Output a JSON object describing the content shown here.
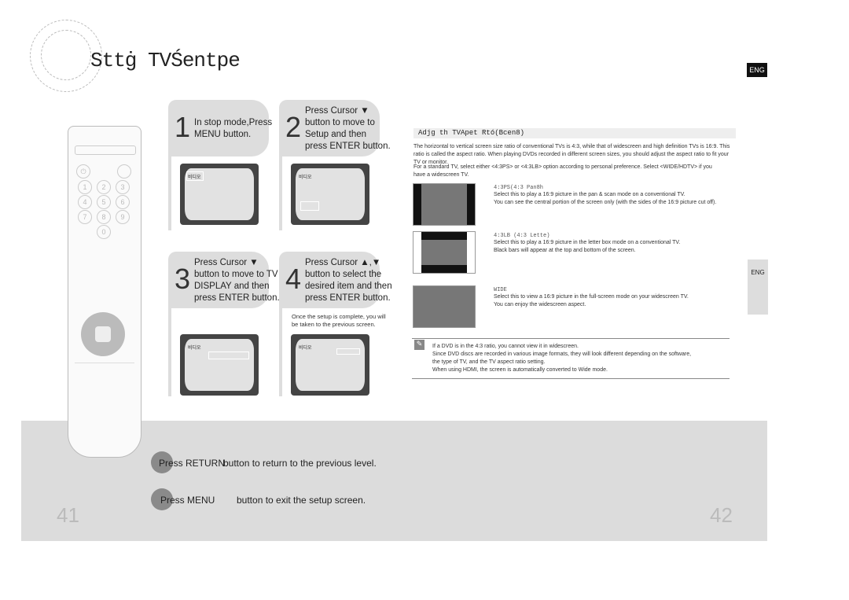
{
  "title": "Sttġ TVŚentpe",
  "eng_tab": "ENG",
  "side_tab": "ENG",
  "steps": [
    {
      "num": "1",
      "lines": [
        "In stop mode,Press",
        "MENU    button."
      ],
      "screen_label": "비디오"
    },
    {
      "num": "2",
      "lines": [
        "Press Cursor ▼",
        "button to move to",
        " Setup  and then",
        "press ENTER     button."
      ],
      "screen_label": "비디오"
    },
    {
      "num": "3",
      "lines": [
        "Press Cursor ▼",
        "button to move to  TV",
        "DISPLAY  and then",
        "press ENTER     button."
      ],
      "screen_label": "비디오"
    },
    {
      "num": "4",
      "lines": [
        "Press Cursor  ▲,▼",
        "button to select the",
        "desired item and then",
        "press ENTER     button."
      ],
      "screen_label": "비디오",
      "note": "Once the setup is complete, you will be taken to the previous screen."
    }
  ],
  "section_heading": "Adjg th TVApet Rtó(Bcen8)",
  "intro": [
    "The horizontal to vertical screen size ratio of conventional TVs is 4:3, while that of widescreen and high definition TVs is 16:9. This ratio is called the aspect ratio. When playing DVDs recorded in different screen sizes, you should adjust the aspect ratio to fit your TV or monitor.",
    "For a standard TV, select either <4:3PS> or <4:3LB> option according to personal preference. Select <WIDE/HDTV> if you have a widescreen TV."
  ],
  "options": [
    {
      "name": "4:3PS(4:3 Pan8h",
      "lines": [
        "Select this to play a 16:9 picture in the pan & scan mode on a conventional TV.",
        "  You can see the central portion of the screen only (with the sides of the 16:9 picture cut off)."
      ]
    },
    {
      "name": "4:3LB (4:3 Lette)",
      "lines": [
        "Select this to play a 16:9 picture in the letter box mode on a conventional TV.",
        "  Black bars will appear at the top and bottom of the screen."
      ]
    },
    {
      "name": "WIDE",
      "lines": [
        "Select this to view a 16:9 picture in the full-screen mode on your widescreen TV.",
        "  You can enjoy the widescreen aspect."
      ]
    }
  ],
  "notes": [
    "If a DVD is in the 4:3 ratio, you cannot view it in widescreen.",
    "Since DVD discs are recorded in various image formats, they will look different depending on the software,",
    "the type of TV, and the TV aspect ratio setting.",
    "When using HDMI, the screen is automatically converted to Wide mode."
  ],
  "bottom": [
    {
      "press": "Press RETURN",
      "text": "button to return to the previous level."
    },
    {
      "press": "Press MENU",
      "text": "button to exit the setup screen."
    }
  ],
  "remote_keys": [
    "1",
    "2",
    "3",
    "4",
    "5",
    "6",
    "7",
    "8",
    "9",
    "0"
  ],
  "page_left": "41",
  "page_right": "42"
}
